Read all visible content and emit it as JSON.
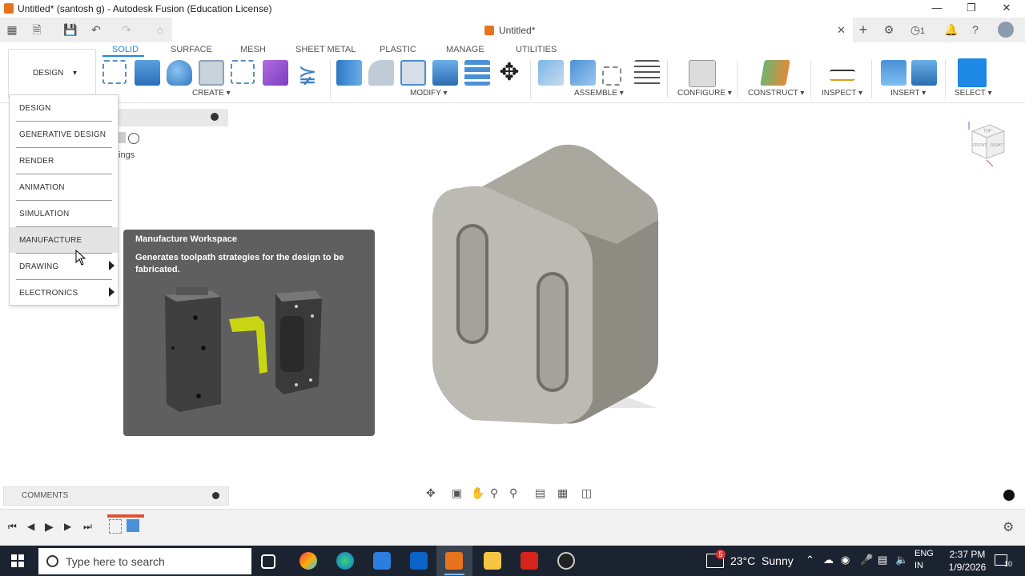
{
  "window": {
    "title": "Untitled* (santosh g) - Autodesk Fusion (Education License)"
  },
  "tabbar": {
    "doc_tab": "Untitled*",
    "account_badge": "1"
  },
  "ribbon": {
    "workspace_button": "DESIGN",
    "tabs": [
      "SOLID",
      "SURFACE",
      "MESH",
      "SHEET METAL",
      "PLASTIC",
      "MANAGE",
      "UTILITIES"
    ],
    "active_tab": "SOLID",
    "groups": [
      "CREATE",
      "MODIFY",
      "ASSEMBLE",
      "CONFIGURE",
      "CONSTRUCT",
      "INSPECT",
      "INSERT",
      "SELECT"
    ]
  },
  "workspace_menu": {
    "items": [
      {
        "label": "DESIGN",
        "submenu": false
      },
      {
        "label": "GENERATIVE DESIGN",
        "submenu": false
      },
      {
        "label": "RENDER",
        "submenu": false
      },
      {
        "label": "ANIMATION",
        "submenu": false
      },
      {
        "label": "SIMULATION",
        "submenu": false
      },
      {
        "label": "MANUFACTURE",
        "submenu": false,
        "hover": true
      },
      {
        "label": "DRAWING",
        "submenu": true
      },
      {
        "label": "ELECTRONICS",
        "submenu": true
      }
    ]
  },
  "browser_fragment": "tings",
  "tooltip": {
    "title": "Manufacture Workspace",
    "description": "Generates toolpath strategies for the design to be fabricated."
  },
  "comments": {
    "label": "COMMENTS"
  },
  "viewcube": {
    "labels": [
      "TOP",
      "FRONT",
      "RIGHT"
    ]
  },
  "taskbar": {
    "search_placeholder": "Type here to search",
    "weather_badge": "5",
    "weather": "23°C  Sunny",
    "lang1": "ENG",
    "lang2": "IN",
    "time": "2:37 PM",
    "date": "1/9/2026",
    "notif_badge": "10"
  },
  "colors": {
    "accent": "#1e88e5",
    "fusion_orange": "#e8731f",
    "taskbar": "#1c2330",
    "tooltip_bg": "#5f5f5f"
  }
}
